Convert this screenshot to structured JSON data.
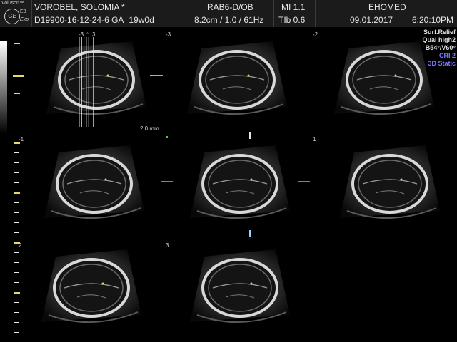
{
  "header": {
    "brand": "Voluson™",
    "logo": "GE",
    "model": "E8",
    "mode": "Exp",
    "patient_name": "VOROBEL, SOLOMIA  *",
    "patient_id": "D19900-16-12-24-6  GA=19w0d",
    "probe": "RAB6-D/OB",
    "probe_params": "8.2cm / 1.0 / 61Hz",
    "mi": "MI  1.1",
    "tib": "TIb  0.6",
    "clinic": "EHOMED",
    "date": "09.01.2017",
    "time": "6:20:10PM"
  },
  "info_panel": {
    "line1": "Surf.Relief",
    "line2": "Qual high2",
    "line3": "B54°/V60°",
    "line4": "CRI 2",
    "line5": "3D Static",
    "line4_color": "#7a7aff",
    "line5_color": "#7a7aff"
  },
  "slice_labels": {
    "t1_left": "-3",
    "t1_star": "*",
    "t1_right": "3",
    "t2": "-3",
    "t3": "-2",
    "row2_left": "-1",
    "t6": "1",
    "row3_left": "2",
    "t8": "3",
    "spacing": "2.0 mm"
  },
  "colors": {
    "header_bg": "#1b1b1b",
    "marker_yellow": "#e6d86a",
    "marker_orange": "#d9652b",
    "marker_blue": "#9ad0ff"
  }
}
